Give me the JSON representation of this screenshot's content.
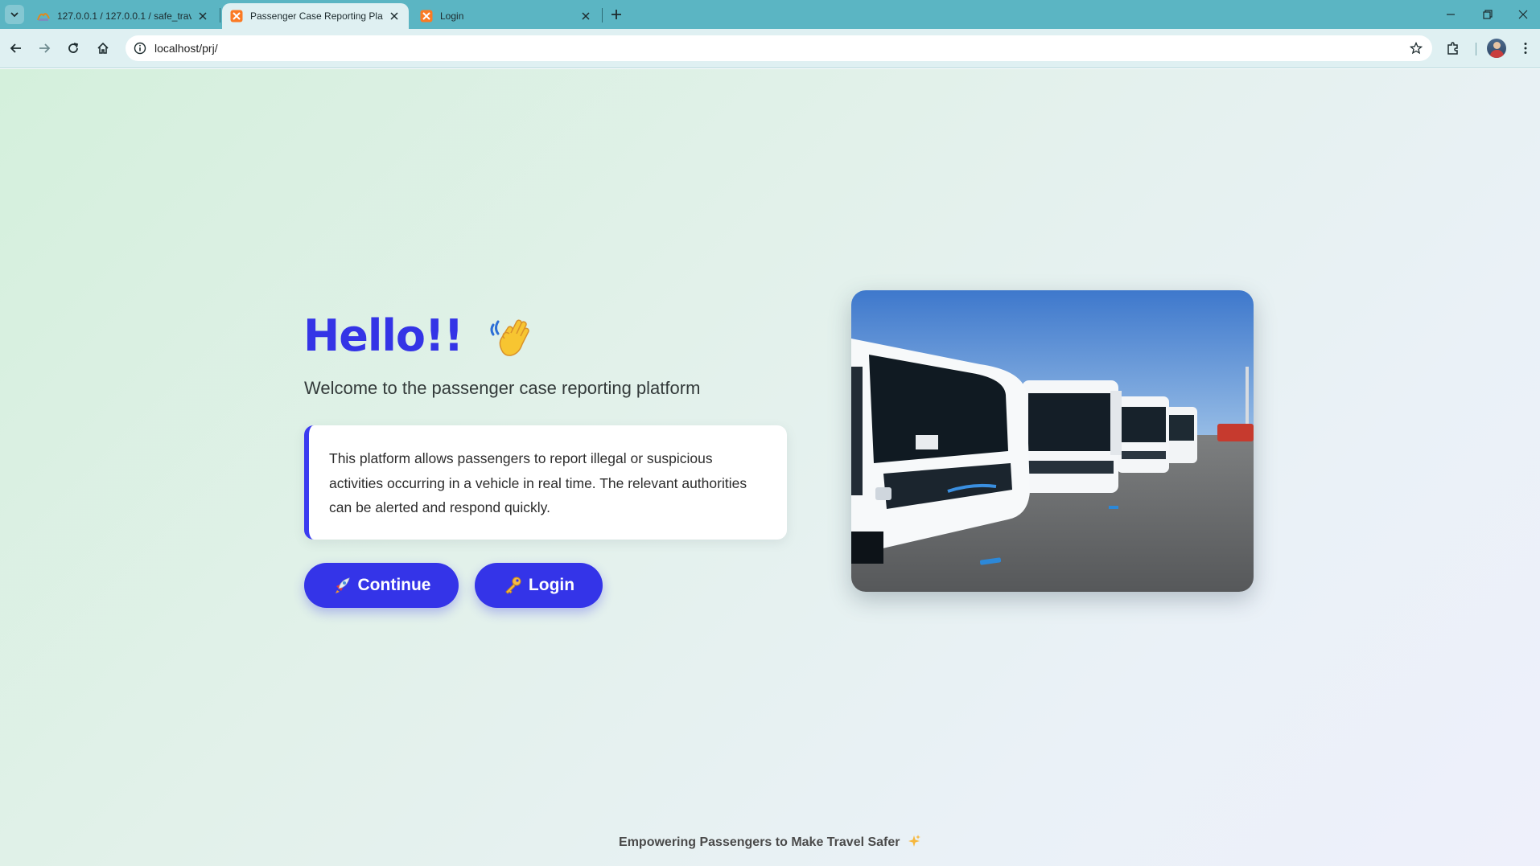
{
  "browser": {
    "tabs": [
      {
        "title": "127.0.0.1 / 127.0.0.1 / safe_trave",
        "favicon": "phpmyadmin-icon",
        "active": false
      },
      {
        "title": "Passenger Case Reporting Platfo",
        "favicon": "xampp-icon",
        "active": true
      },
      {
        "title": "Login",
        "favicon": "xampp-icon",
        "active": false
      }
    ],
    "url": "localhost/prj/"
  },
  "page": {
    "heading": "Hello!!",
    "heading_emoji": "waving-hand-icon",
    "subtitle": "Welcome to the passenger case reporting platform",
    "description": "This platform allows passengers to report illegal or suspicious activities occurring in a vehicle in real time. The relevant authorities can be alerted and respond quickly.",
    "buttons": {
      "continue": {
        "label": "Continue",
        "icon": "rocket-icon"
      },
      "login": {
        "label": "Login",
        "icon": "key-icon"
      }
    },
    "footer": "Empowering Passengers to Make Travel Safer",
    "footer_icon": "sparkles-icon"
  },
  "colors": {
    "accent": "#3434e8",
    "tabstrip": "#5bb5c3",
    "toolbar": "#dff0f2"
  }
}
